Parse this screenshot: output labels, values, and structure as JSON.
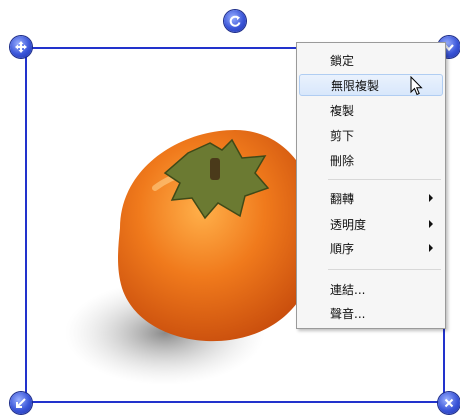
{
  "menu": {
    "items": [
      {
        "label": "鎖定"
      },
      {
        "label": "無限複製"
      },
      {
        "label": "複製"
      },
      {
        "label": "剪下"
      },
      {
        "label": "刪除"
      },
      {
        "label": "翻轉"
      },
      {
        "label": "透明度"
      },
      {
        "label": "順序"
      },
      {
        "label": "連結..."
      },
      {
        "label": "聲音..."
      }
    ]
  },
  "colors": {
    "selection_border": "#2233cc",
    "handle": "#3a55d8",
    "menu_hover": "#d8e7fb"
  },
  "icons": {
    "rotate_handle": "rotate-icon",
    "move_handle": "move-icon",
    "menu_handle": "chevron-down-icon",
    "resize_handle": "resize-icon",
    "delete_handle": "close-icon"
  }
}
